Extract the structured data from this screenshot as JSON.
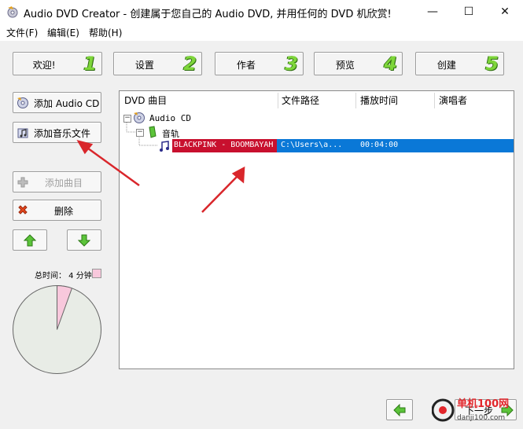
{
  "window": {
    "title": "Audio DVD Creator - 创建属于您自己的 Audio DVD, 并用任何的 DVD 机欣赏!",
    "minimize_glyph": "—",
    "maximize_glyph": "☐",
    "close_glyph": "✕"
  },
  "menu": [
    "文件(F)",
    "编辑(E)",
    "帮助(H)"
  ],
  "steps": [
    {
      "label": "欢迎!",
      "num": "1"
    },
    {
      "label": "设置",
      "num": "2"
    },
    {
      "label": "作者",
      "num": "3"
    },
    {
      "label": "预览",
      "num": "4"
    },
    {
      "label": "创建",
      "num": "5"
    }
  ],
  "sidebar": {
    "add_audio_cd": "添加 Audio CD",
    "add_music_file": "添加音乐文件",
    "add_track": "添加曲目",
    "delete": "删除",
    "total_time_label": "总时间： 4 分钟"
  },
  "table": {
    "columns": [
      "DVD 曲目",
      "文件路径",
      "播放时间",
      "演唱者"
    ],
    "tree": {
      "root": "Audio CD",
      "group": "音轨",
      "track": {
        "title": "BLACKPINK - BOOMBAYAH",
        "path": "C:\\Users\\a...",
        "duration": "00:04:00",
        "artist": ""
      }
    }
  },
  "footer": {
    "next_label": "下一步",
    "watermark_text": "单机100网",
    "watermark_url": "danji100.com"
  },
  "colors": {
    "selection": "#0a78d7",
    "title_highlight": "#c8102e",
    "step_number": "#7ed63a",
    "pie_fill": "#e8ece6",
    "pie_slice": "#f8c8dc",
    "arrow": "#d9262b"
  },
  "pie": {
    "used_fraction": 0.055
  }
}
